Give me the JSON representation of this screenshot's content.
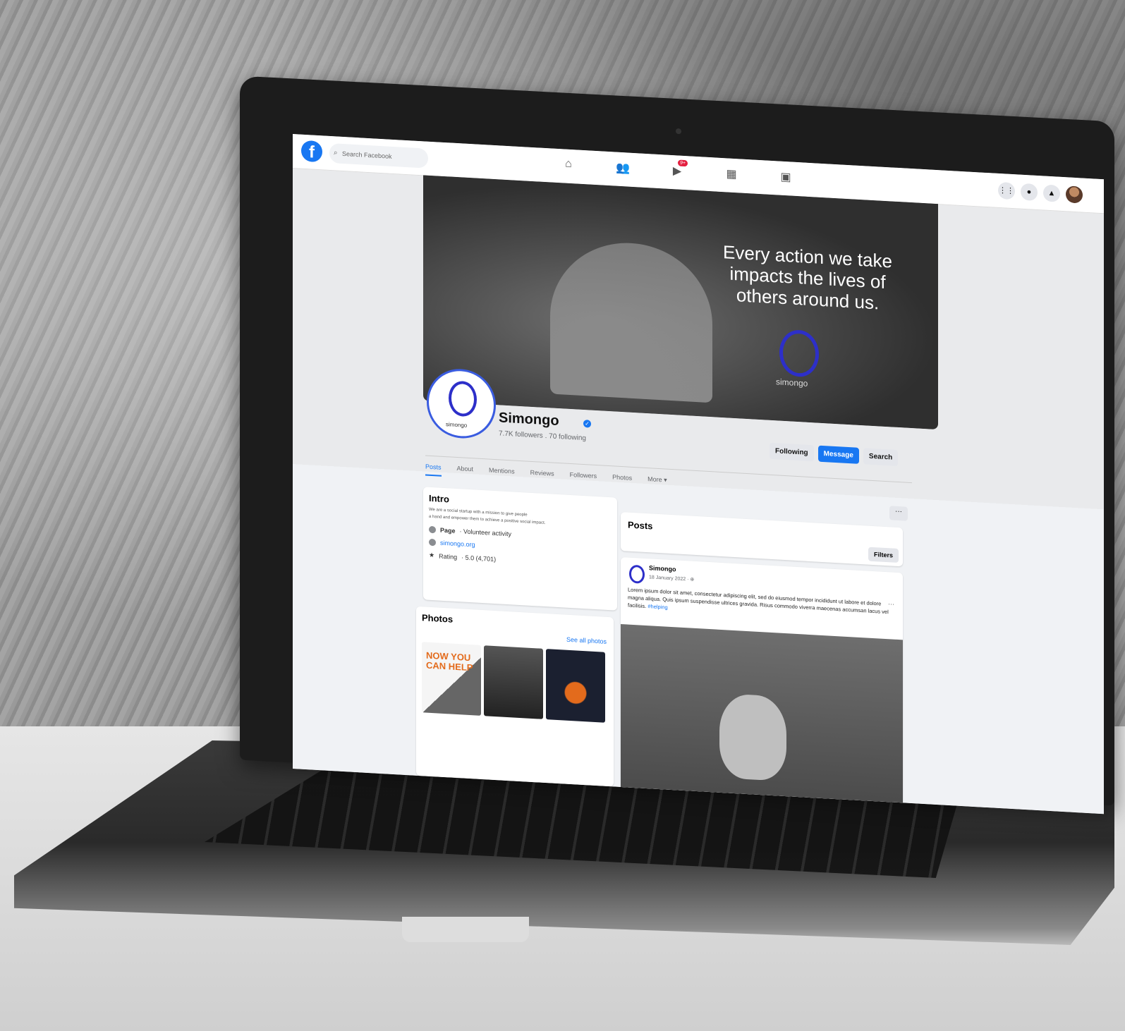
{
  "search": {
    "placeholder": "Search Facebook"
  },
  "nav": {
    "badge": "9+"
  },
  "cover": {
    "quote": "Every action we take impacts the lives of others around us.",
    "logo_text": "simongo"
  },
  "profile": {
    "logo_text": "simongo",
    "name": "Simongo",
    "followers": "7.7K followers . 70 following"
  },
  "actions": {
    "following": "Following",
    "message": "Message",
    "search": "Search"
  },
  "tabs": [
    "Posts",
    "About",
    "Mentions",
    "Reviews",
    "Followers",
    "Photos",
    "More ▾"
  ],
  "intro": {
    "title": "Intro",
    "desc1": "We are a social startup with a mission to give people",
    "desc2": "a hand and empower them to achieve a positive social impact.",
    "page_label": "Page",
    "page_value": " · Volunteer activity",
    "website": "simongo.org",
    "rating_label": "Rating",
    "rating_value": " · 5.0 (4,701)"
  },
  "photos": {
    "title": "Photos",
    "see_all": "See all photos",
    "tile1": "NOW YOU CAN HELP"
  },
  "posts": {
    "title": "Posts",
    "filters": "Filters",
    "author": "Simongo",
    "date": "18 January 2022 · ⊕",
    "body": "Lorem ipsum dolor sit amet, consectetur adipiscing elit, sed do eiusmod tempor incididunt ut labore et dolore magna aliqua. Quis ipsum suspendisse ultrices gravida. Risus commodo viverra maecenas accumsan lacus vel facilisis.",
    "hashtag": "#helping"
  },
  "colors": {
    "brand": "#1877f2",
    "logo": "#2d2fc9"
  }
}
